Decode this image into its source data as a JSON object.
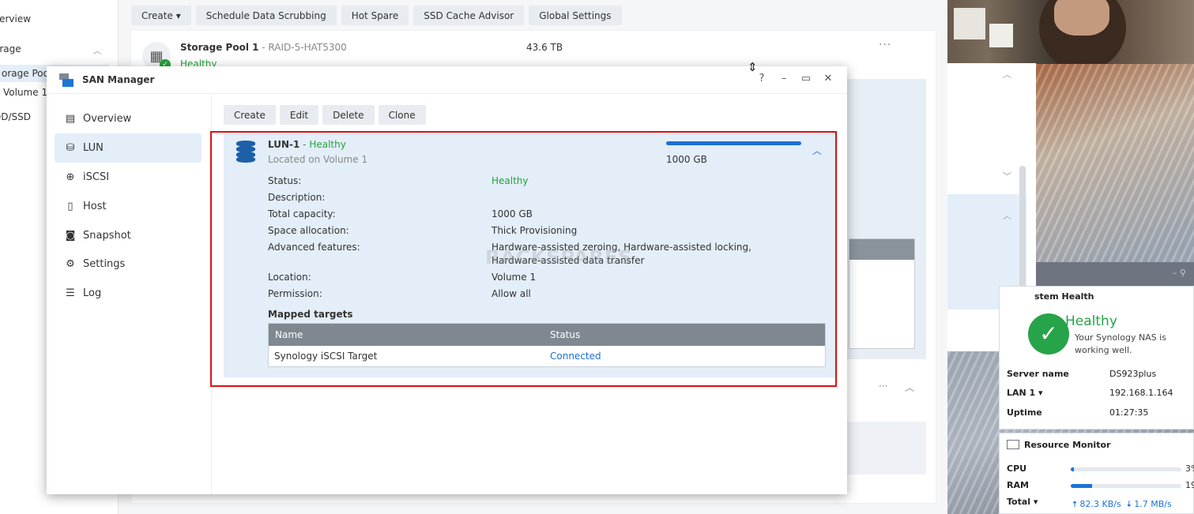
{
  "background_window": {
    "sidebar": {
      "items": [
        {
          "label": "verview"
        },
        {
          "label": "orage"
        },
        {
          "label": "orage Pool"
        },
        {
          "label": "Volume 1"
        },
        {
          "label": "DD/SSD"
        }
      ]
    },
    "toolbar": {
      "create": "Create ▾",
      "schedule": "Schedule Data Scrubbing",
      "hot_spare": "Hot Spare",
      "ssd_cache": "SSD Cache Advisor",
      "global_settings": "Global Settings"
    },
    "pool": {
      "title": "Storage Pool 1",
      "subtitle": " - RAID-5-HAT5300",
      "size": "43.6 TB",
      "status": "Healthy"
    }
  },
  "san_manager": {
    "title": "SAN Manager",
    "help": "?",
    "minimize": "–",
    "maximize": "▭",
    "close": "✕",
    "nav": [
      {
        "label": "Overview",
        "icon": "overview-icon"
      },
      {
        "label": "LUN",
        "icon": "database-icon"
      },
      {
        "label": "iSCSI",
        "icon": "globe-icon"
      },
      {
        "label": "Host",
        "icon": "host-icon"
      },
      {
        "label": "Snapshot",
        "icon": "camera-icon"
      },
      {
        "label": "Settings",
        "icon": "gear-icon"
      },
      {
        "label": "Log",
        "icon": "list-icon"
      }
    ],
    "active_nav": "LUN",
    "toolbar": {
      "create": "Create",
      "edit": "Edit",
      "delete": "Delete",
      "clone": "Clone"
    },
    "lun": {
      "name": "LUN-1",
      "separator": " - ",
      "health": "Healthy",
      "location_line": "Located on Volume 1",
      "usage_fraction": 1.0,
      "size": "1000 GB",
      "details": [
        {
          "label": "Status:",
          "value": "Healthy"
        },
        {
          "label": "Description:",
          "value": ""
        },
        {
          "label": "Total capacity:",
          "value": "1000 GB"
        },
        {
          "label": "Space allocation:",
          "value": "Thick Provisioning"
        },
        {
          "label": "Advanced features:",
          "value": "Hardware-assisted zeroing, Hardware-assisted locking, Hardware-assisted data transfer"
        },
        {
          "label": "Location:",
          "value": "Volume 1"
        },
        {
          "label": "Permission:",
          "value": "Allow all"
        }
      ],
      "mapped_title": "Mapped targets",
      "mapped_columns": {
        "name": "Name",
        "status": "Status"
      },
      "mapped_rows": [
        {
          "name": "Synology iSCSI Target",
          "status": "Connected"
        }
      ]
    },
    "watermark": "RACKSPARES"
  },
  "widgets": {
    "health": {
      "title": "stem Health",
      "status": "Healthy",
      "description": "Your Synology NAS is working well.",
      "rows": [
        {
          "key": "Server name",
          "value": "DS923plus"
        },
        {
          "key": "LAN 1 ▾",
          "value": "192.168.1.164"
        },
        {
          "key": "Uptime",
          "value": "01:27:35"
        }
      ]
    },
    "resource": {
      "title": "Resource Monitor",
      "cpu_label": "CPU",
      "cpu_fraction": 0.03,
      "cpu_text": "3%",
      "ram_label": "RAM",
      "ram_fraction": 0.19,
      "ram_text": "19",
      "total_label": "Total ▾",
      "upload": "82.3 KB/s",
      "download": "1.7 MB/s"
    }
  },
  "colors": {
    "accent": "#1c6fd2",
    "healthy": "#22a33a",
    "highlight": "#dd1111",
    "selection": "#e3eef9"
  }
}
